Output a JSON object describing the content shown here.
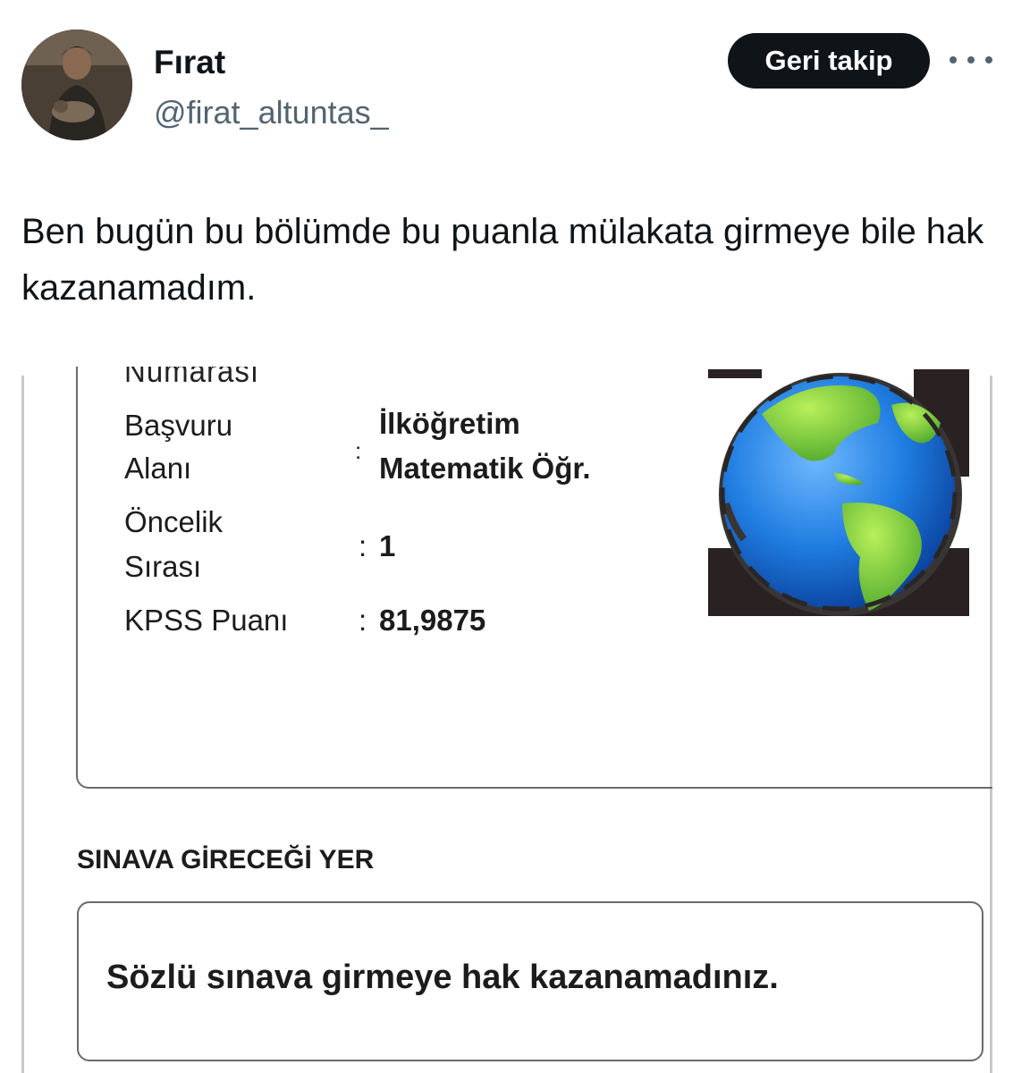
{
  "user": {
    "display_name": "Fırat",
    "handle": "@firat_altuntas_",
    "avatar_icon": "profile-photo"
  },
  "actions": {
    "follow_label": "Geri takip",
    "more_icon": "more-horizontal-icon"
  },
  "tweet": {
    "text": "Ben bugün bu bölümde bu puanla mülakata girmeye bile hak kazanamadım."
  },
  "media": {
    "cut_label": "Numarası",
    "rows": [
      {
        "label_line1": "Başvuru",
        "label_line2": "Alanı",
        "separator": ":",
        "value_line1": "İlköğretim",
        "value_line2": "Matematik Öğr."
      },
      {
        "label_line1": "Öncelik",
        "label_line2": "Sırası",
        "separator": ":",
        "value": "1"
      },
      {
        "label": "KPSS Puanı",
        "separator": ":",
        "value": "81,9875"
      }
    ],
    "section_title": "SINAVA GİRECEĞİ YER",
    "result_text": "Sözlü sınava girmeye hak kazanamadınız.",
    "globe_icon": "globe-icon"
  },
  "colors": {
    "text": "#0f1419",
    "secondary": "#536471",
    "button_bg": "#0f1419",
    "button_text": "#ffffff"
  }
}
